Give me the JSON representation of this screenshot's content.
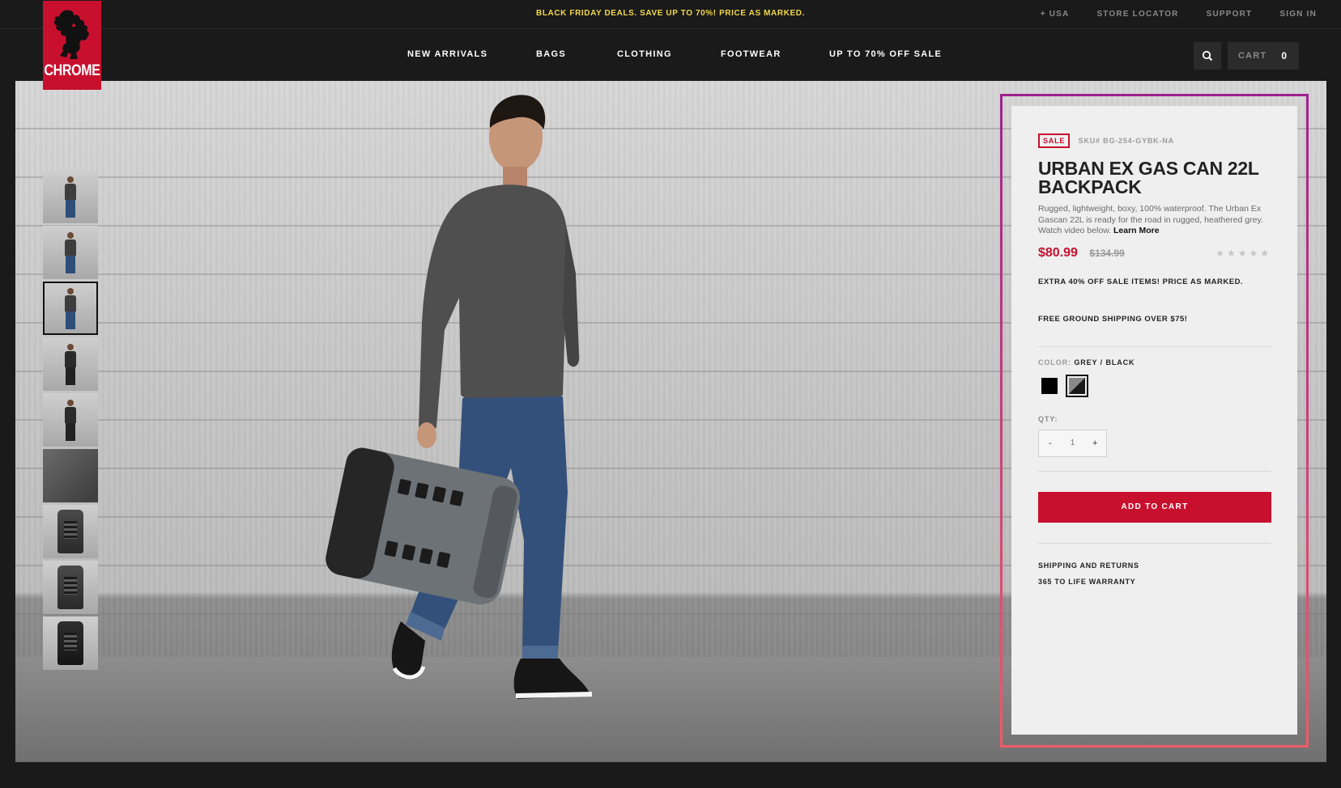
{
  "header": {
    "promo": "BLACK FRIDAY DEALS. SAVE UP TO 70%! PRICE AS MARKED.",
    "utility": {
      "region": "+ USA",
      "store_locator": "STORE LOCATOR",
      "support": "SUPPORT",
      "sign_in": "SIGN IN"
    },
    "logo_text": "CHROME",
    "nav": {
      "new_arrivals": "NEW ARRIVALS",
      "bags": "BAGS",
      "clothing": "CLOTHING",
      "footwear": "FOOTWEAR",
      "sale": "UP TO 70% OFF SALE"
    },
    "cart_label": "CART",
    "cart_count": "0"
  },
  "gallery": {
    "thumbnail_count": 9,
    "active_index": 2
  },
  "product": {
    "badge": "SALE",
    "sku": "SKU# BG-254-GYBK-NA",
    "title": "URBAN EX GAS CAN 22L BACKPACK",
    "description": "Rugged, lightweight, boxy, 100% waterproof. The Urban Ex Gascan 22L is ready for the road in rugged, heathered grey. Watch video below.",
    "learn_more": "Learn More",
    "price_now": "$80.99",
    "price_was": "$134.99",
    "rating": 0,
    "rating_max": 5,
    "promo_line_1": "EXTRA 40% OFF SALE ITEMS! PRICE AS MARKED.",
    "promo_line_2": "FREE GROUND SHIPPING OVER $75!",
    "color_label": "COLOR:",
    "color_value": "GREY / BLACK",
    "swatches": [
      {
        "name": "black",
        "color": "#000000"
      },
      {
        "name": "grey-black",
        "color": "#6e6e6e"
      }
    ],
    "qty_label": "QTY:",
    "qty_minus": "-",
    "qty_value": "1",
    "qty_plus": "+",
    "add_to_cart": "ADD TO CART",
    "shipping_link": "SHIPPING AND RETURNS",
    "warranty_link": "365 TO LIFE WARRANTY"
  },
  "colors": {
    "brand_red": "#c8102e",
    "promo_yellow": "#f2d94e",
    "header_bg": "#1a1a1a"
  }
}
